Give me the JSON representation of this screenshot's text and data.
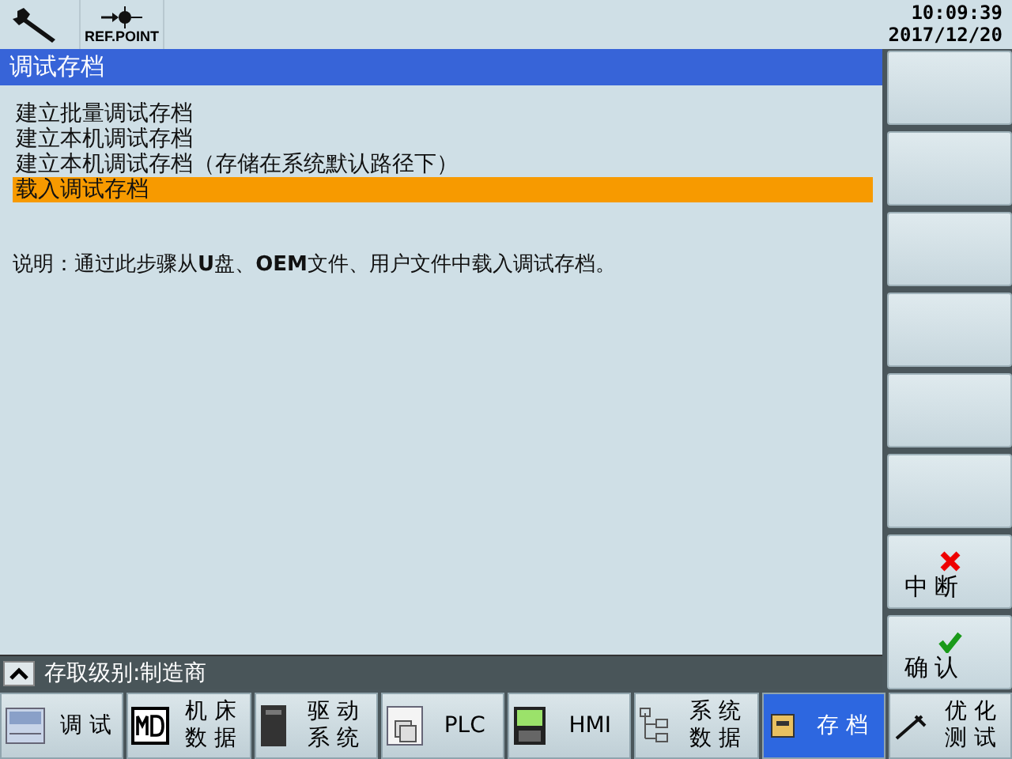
{
  "header": {
    "reference_label": "REF.POINT",
    "time": "10:09:39",
    "date": "2017/12/20"
  },
  "title": "调试存档",
  "menu_items": [
    {
      "label": "建立批量调试存档",
      "selected": false
    },
    {
      "label": "建立本机调试存档",
      "selected": false
    },
    {
      "label": "建立本机调试存档（存储在系统默认路径下）",
      "selected": false
    },
    {
      "label": "载入调试存档",
      "selected": true
    }
  ],
  "note": "说明：通过此步骤从**U**盘、**OEM**文件、用户文件中载入调试存档。",
  "vertical_softkeys": [
    {
      "kind": "blank"
    },
    {
      "kind": "blank"
    },
    {
      "kind": "blank"
    },
    {
      "kind": "blank"
    },
    {
      "kind": "blank"
    },
    {
      "kind": "blank"
    },
    {
      "kind": "cancel",
      "label": "中 断"
    },
    {
      "kind": "confirm",
      "label": "确 认"
    }
  ],
  "status_bar": {
    "text": "存取级别:制造商"
  },
  "horizontal_softkeys": [
    {
      "kind": "sinu",
      "lines": [
        "调 试"
      ],
      "selected": false
    },
    {
      "kind": "md",
      "lines": [
        "机 床",
        "数 据"
      ],
      "selected": false
    },
    {
      "kind": "drive",
      "lines": [
        "驱 动",
        "系 统"
      ],
      "selected": false
    },
    {
      "kind": "plc",
      "lines": [
        "PLC"
      ],
      "selected": false
    },
    {
      "kind": "hmi",
      "lines": [
        "HMI"
      ],
      "selected": false
    },
    {
      "kind": "tree",
      "lines": [
        "系 统",
        "数 据"
      ],
      "selected": false
    },
    {
      "kind": "archive",
      "lines": [
        "存 档"
      ],
      "selected": true
    },
    {
      "kind": "optimize",
      "lines": [
        "优 化",
        "测 试"
      ],
      "selected": false
    }
  ]
}
